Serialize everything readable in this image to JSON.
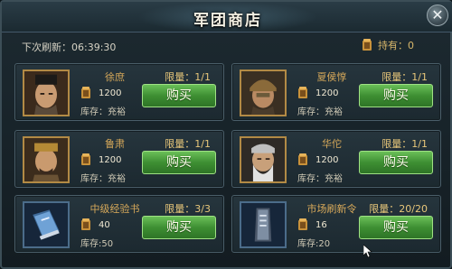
{
  "title": "军团商店",
  "refresh": "下次刷新：06:39:30",
  "owned": "持有：0",
  "close_symbol": "✕",
  "colors": {
    "accent_gold": "#d7a95a",
    "button_green": "#3e8f33"
  },
  "items": [
    {
      "name": "徐庶",
      "limit": "限量：1/1",
      "price": "1200",
      "stock": "库存：充裕",
      "buy": "购买",
      "icon": "portrait-xushu"
    },
    {
      "name": "夏侯惇",
      "limit": "限量：1/1",
      "price": "1200",
      "stock": "库存：充裕",
      "buy": "购买",
      "icon": "portrait-xiahoudun"
    },
    {
      "name": "鲁肃",
      "limit": "限量：1/1",
      "price": "1200",
      "stock": "库存：充裕",
      "buy": "购买",
      "icon": "portrait-lusu"
    },
    {
      "name": "华佗",
      "limit": "限量：1/1",
      "price": "1200",
      "stock": "库存：充裕",
      "buy": "购买",
      "icon": "portrait-huatuo"
    },
    {
      "name": "中级经验书",
      "limit": "限量：3/3",
      "price": "40",
      "stock": "库存:50",
      "buy": "购买",
      "icon": "exp-book-icon"
    },
    {
      "name": "市场刷新令",
      "limit": "限量：20/20",
      "price": "16",
      "stock": "库存:20",
      "buy": "购买",
      "icon": "refresh-token-icon"
    }
  ]
}
